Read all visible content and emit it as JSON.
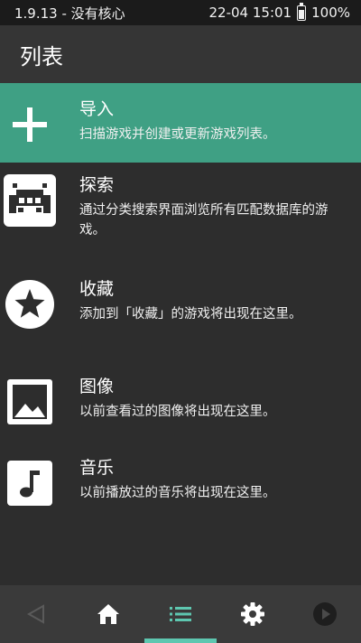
{
  "status_bar": {
    "app_version": "1.9.13 - 没有核心",
    "datetime": "22-04 15:01",
    "battery": "100%"
  },
  "header": {
    "title": "列表"
  },
  "items": [
    {
      "title": "导入",
      "description": "扫描游戏并创建或更新游戏列表。",
      "icon": "plus-icon"
    },
    {
      "title": "探索",
      "description": "通过分类搜索界面浏览所有匹配数据库的游戏。",
      "icon": "retroarch-invader-icon"
    },
    {
      "title": "收藏",
      "description": "添加到「收藏」的游戏将出现在这里。",
      "icon": "star-icon"
    },
    {
      "title": "图像",
      "description": "以前查看过的图像将出现在这里。",
      "icon": "image-icon"
    },
    {
      "title": "音乐",
      "description": "以前播放过的音乐将出现在这里。",
      "icon": "music-note-icon"
    }
  ],
  "bottom_nav": {
    "buttons": [
      "back-icon",
      "home-icon",
      "list-icon",
      "gear-icon",
      "play-icon"
    ],
    "active": "list-icon",
    "active_color": "#5ec7b0"
  },
  "colors": {
    "selected_item": "#3fa084",
    "background": "#2d2d2d"
  }
}
